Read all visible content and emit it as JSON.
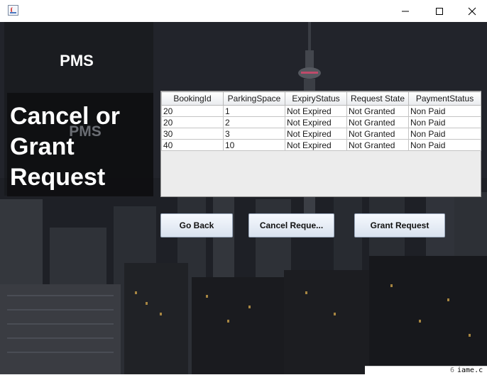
{
  "window": {
    "title": "",
    "controls": [
      "minimize-icon",
      "maximize-icon",
      "close-icon"
    ]
  },
  "sidebar": {
    "app_name": "PMS",
    "heading": "Cancel or Grant Request",
    "watermark": "PMS"
  },
  "table": {
    "columns": [
      "BookingId",
      "ParkingSpace",
      "ExpiryStatus",
      "Request State",
      "PaymentStatus"
    ],
    "rows": [
      [
        "20",
        "1",
        "Not Expired",
        "Not Granted",
        "Non Paid"
      ],
      [
        "20",
        "2",
        "Not Expired",
        "Not Granted",
        "Non Paid"
      ],
      [
        "30",
        "3",
        "Not Expired",
        "Not Granted",
        "Non Paid"
      ],
      [
        "40",
        "10",
        "Not Expired",
        "Not Granted",
        "Non Paid"
      ]
    ]
  },
  "buttons": {
    "go_back": "Go Back",
    "cancel_request": "Cancel Reque...",
    "grant_request": "Grant Request"
  },
  "editor_strip": {
    "line_number": "6",
    "code": "iame.c"
  },
  "colors": {
    "background": "#1c1e23",
    "heading_text": "#ffffff",
    "button_face": "#e6edf6"
  }
}
